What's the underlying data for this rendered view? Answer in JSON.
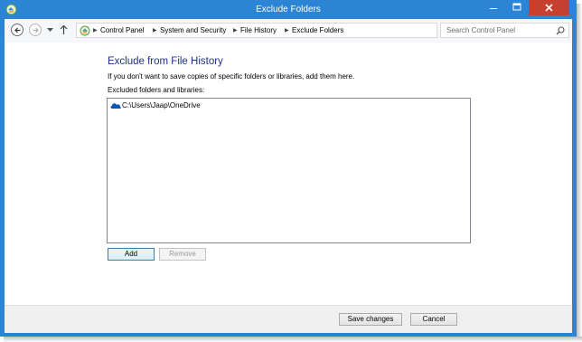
{
  "window": {
    "title": "Exclude Folders",
    "accent": "#2b85d4",
    "close_color": "#c7402f"
  },
  "nav": {
    "breadcrumb": [
      "Control Panel",
      "System and Security",
      "File History",
      "Exclude Folders"
    ],
    "search_placeholder": "Search Control Panel"
  },
  "main": {
    "heading": "Exclude from File History",
    "description": "If you don't want to save copies of specific folders or libraries, add them here.",
    "list_label": "Excluded folders and libraries:",
    "items": [
      {
        "path": "C:\\Users\\Jaap\\OneDrive",
        "icon": "onedrive-icon"
      }
    ],
    "add_label": "Add",
    "remove_label": "Remove"
  },
  "footer": {
    "save_label": "Save changes",
    "cancel_label": "Cancel"
  }
}
